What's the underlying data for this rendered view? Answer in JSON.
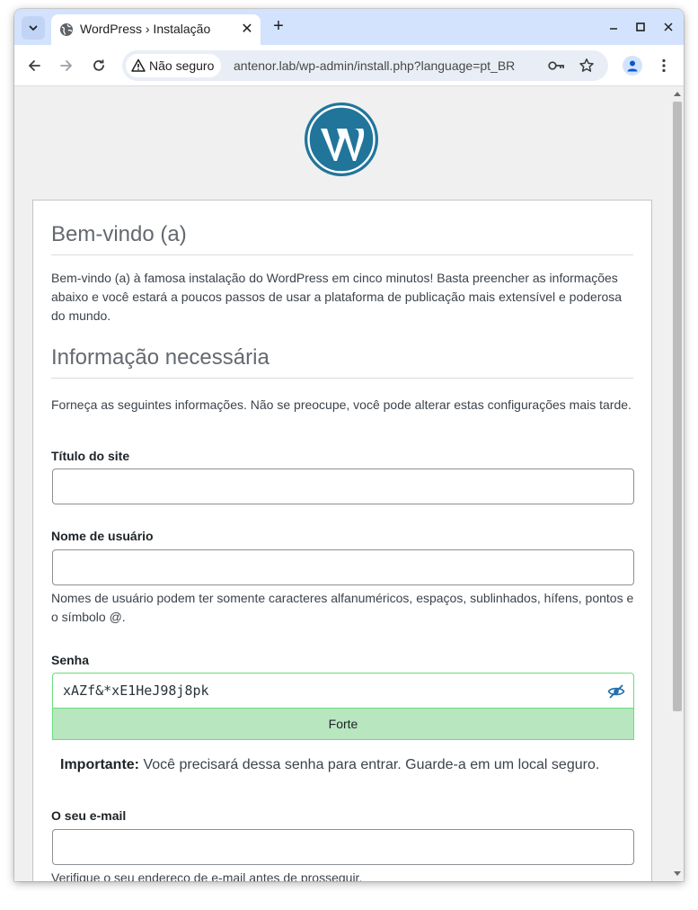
{
  "browser": {
    "tab_title": "WordPress › Instalação",
    "security_label": "Não seguro",
    "url": "antenor.lab/wp-admin/install.php?language=pt_BR"
  },
  "page": {
    "welcome_heading": "Bem-vindo (a)",
    "welcome_text": "Bem-vindo (a) à famosa instalação do WordPress em cinco minutos! Basta preencher as informações abaixo e você estará a poucos passos de usar a plataforma de publicação mais extensível e poderosa do mundo.",
    "info_heading": "Informação necessária",
    "info_text": "Forneça as seguintes informações. Não se preocupe, você pode alterar estas configurações mais tarde.",
    "site_title_label": "Título do site",
    "site_title_value": "",
    "username_label": "Nome de usuário",
    "username_value": "",
    "username_hint": "Nomes de usuário podem ter somente caracteres alfanuméricos, espaços, sublinhados, hífens, pontos e o símbolo @.",
    "password_label": "Senha",
    "password_value": "xAZf&*xE1HeJ98j8pk",
    "password_strength": "Forte",
    "important_label": "Importante:",
    "important_text": " Você precisará dessa senha para entrar. Guarde-a em um local seguro.",
    "email_label": "O seu e-mail",
    "email_value": "",
    "email_hint": "Verifique o seu endereço de e-mail antes de prosseguir."
  },
  "colors": {
    "tabstrip": "#d3e3fd",
    "wp_blue": "#21759b",
    "strength_bg": "#b8e6bf",
    "strength_border": "#68de7c"
  }
}
